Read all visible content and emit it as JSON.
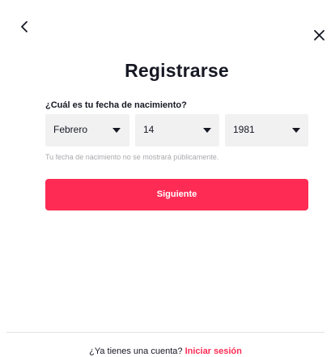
{
  "header": {
    "back_icon": "chevron-left-icon",
    "close_icon": "close-icon"
  },
  "form": {
    "title": "Registrarse",
    "question": "¿Cuál es tu fecha de nacimiento?",
    "month": {
      "value": "Febrero"
    },
    "day": {
      "value": "14"
    },
    "year": {
      "value": "1981"
    },
    "hint": "Tu fecha de nacimiento no se mostrará públicamente.",
    "next_label": "Siguiente"
  },
  "footer": {
    "prompt": "¿Ya tienes una cuenta?",
    "login_label": "Iniciar sesión"
  },
  "colors": {
    "accent": "#fe2c55",
    "select_bg": "#f1f1f2",
    "text": "#161823",
    "muted": "#a8a9ad"
  }
}
